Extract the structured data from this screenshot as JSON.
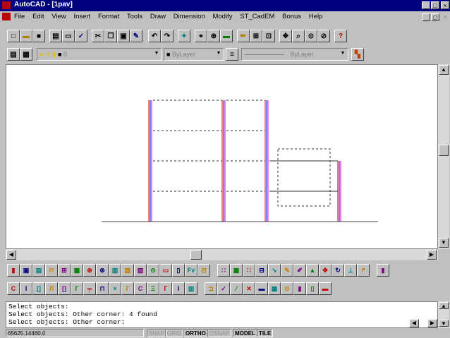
{
  "window": {
    "title": "AutoCAD - [1pav]"
  },
  "menu": [
    "File",
    "Edit",
    "View",
    "Insert",
    "Format",
    "Tools",
    "Draw",
    "Dimension",
    "Modify",
    "ST_CadEM",
    "Bonus",
    "Help"
  ],
  "properties_bar": {
    "layer": "0",
    "color": "ByLayer",
    "linetype": "ByLayer"
  },
  "command_lines": [
    "Select objects:",
    "Select objects: Other corner: 4 found",
    "Select objects: Other corner:"
  ],
  "status": {
    "coords": "65625.14460,0",
    "toggles": [
      {
        "label": "SNAP",
        "on": false
      },
      {
        "label": "GRID",
        "on": false
      },
      {
        "label": "ORTHO",
        "on": true
      },
      {
        "label": "OSNAP",
        "on": false
      },
      {
        "label": "MODEL",
        "on": true
      },
      {
        "label": "TILE",
        "on": true
      }
    ]
  },
  "colors": {
    "title_bg": "#000080",
    "line_red": "#e00000",
    "line_blue": "#0000e0",
    "line_magenta": "#d000d0"
  }
}
